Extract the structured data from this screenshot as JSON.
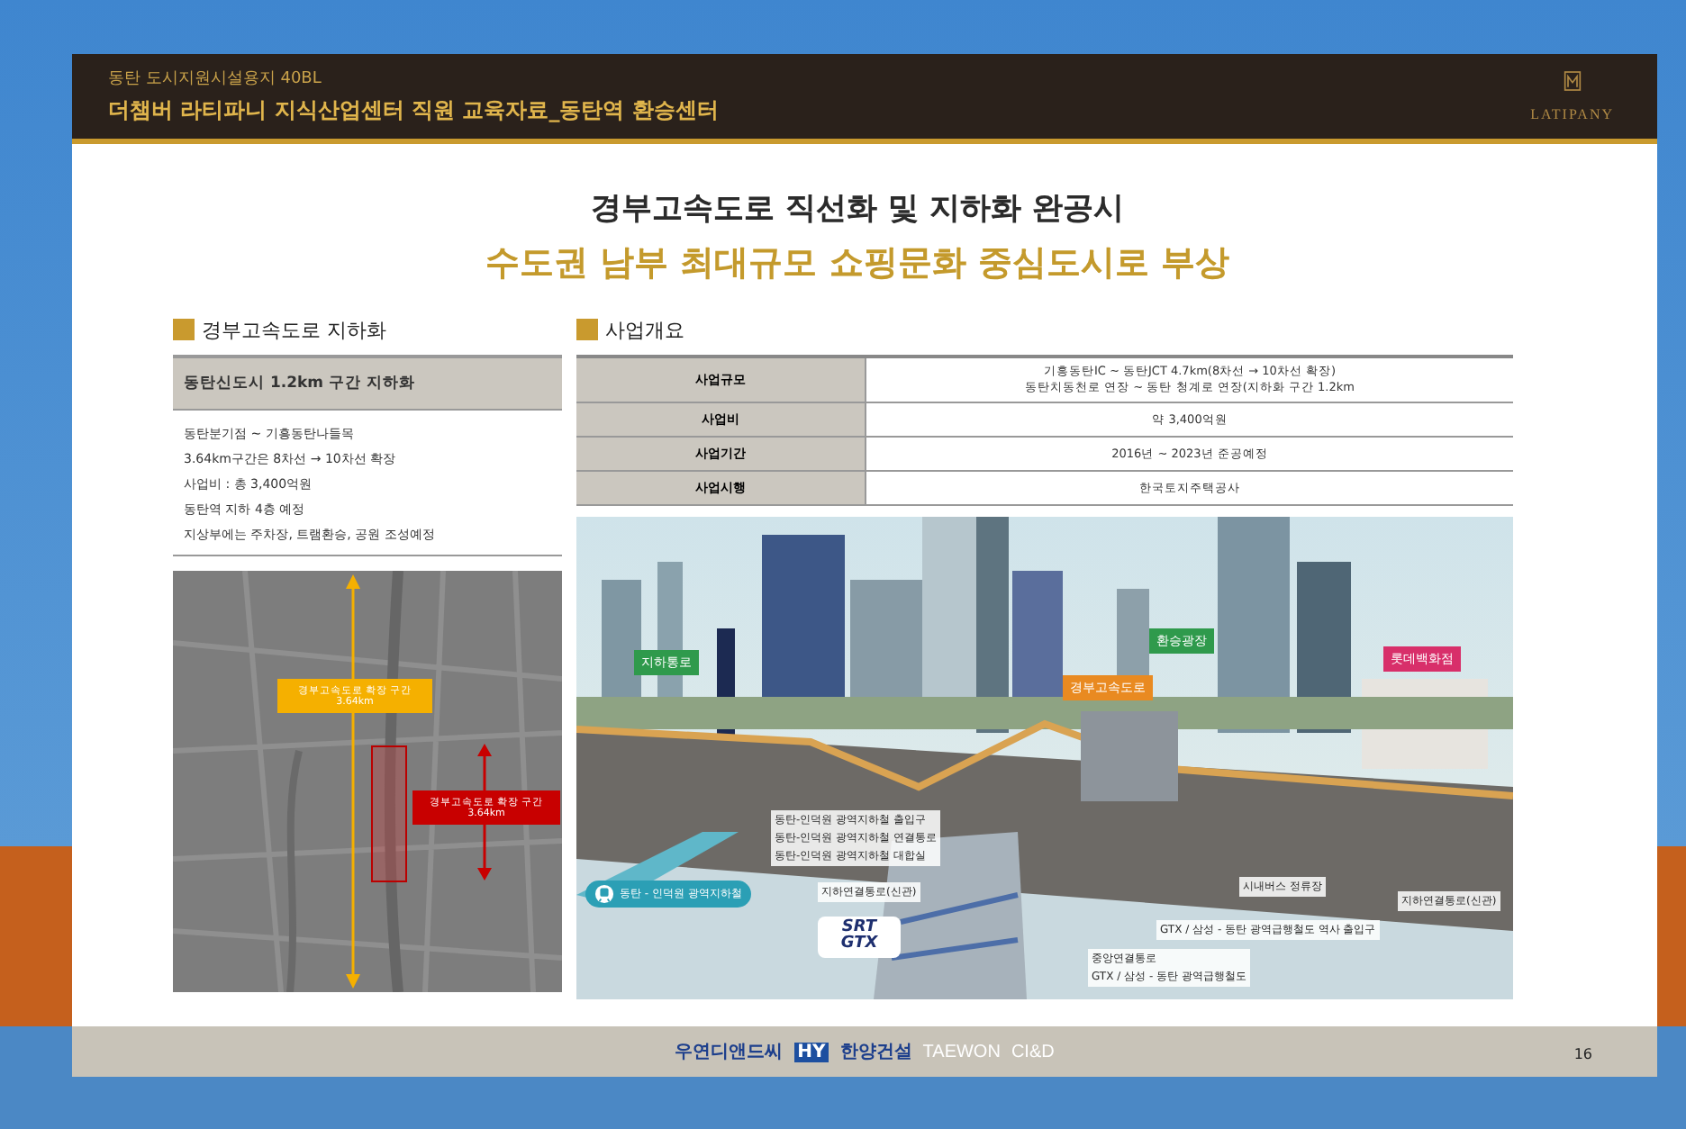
{
  "header": {
    "subtitle": "동탄 도시지원시설용지 40BL",
    "title": "더챔버 라티파니 지식산업센터 직원 교육자료_동탄역 환승센터",
    "logo": "LATIPANY"
  },
  "headline": {
    "line_1": "경부고속도로 직선화 및 지하화 완공시",
    "line_2": "수도권 남부 최대규모 쇼핑문화 중심도시로 부상"
  },
  "left_section": {
    "heading": "경부고속도로 지하화",
    "banner": "동탄신도시 1.2km 구간 지하화",
    "bullets": [
      "동탄분기점 ~ 기흥동탄나들목",
      "3.64km구간은 8차선 → 10차선 확장",
      "사업비 : 총 3,400억원",
      "동탄역 지하 4층 예정",
      "지상부에는 주차장, 트램환승, 공원 조성예정"
    ],
    "map": {
      "callouts": [
        {
          "kind": "yellow",
          "lines": [
            "경부고속도로 확장 구간",
            "3.64km"
          ]
        },
        {
          "kind": "red",
          "lines": [
            "경부고속도로 확장 구간",
            "3.64km"
          ]
        }
      ]
    }
  },
  "right_section": {
    "heading": "사업개요",
    "table": {
      "rows": [
        {
          "label": "사업규모",
          "value": [
            "기흥동탄IC ~ 동탄JCT 4.7km(8차선 → 10차선 확장)",
            "동탄치동천로 연장 ~ 동탄 청계로 연장(지하화 구간 1.2km"
          ]
        },
        {
          "label": "사업비",
          "value": [
            "약 3,400억원"
          ]
        },
        {
          "label": "사업기간",
          "value": [
            "2016년 ~ 2023년 준공예정"
          ]
        },
        {
          "label": "사업시행",
          "value": [
            "한국토지주택공사"
          ]
        }
      ]
    },
    "illustration": {
      "callouts": [
        {
          "kind": "green",
          "lines": [
            "지하통로"
          ]
        },
        {
          "kind": "green",
          "lines": [
            "환승광장"
          ]
        },
        {
          "kind": "orange",
          "lines": [
            "경부고속도로"
          ]
        },
        {
          "kind": "pink",
          "lines": [
            "롯데백화점"
          ]
        },
        {
          "kind": "note",
          "lines": [
            "동탄-인덕원 광역지하철 출입구",
            "동탄-인덕원 광역지하철 연결통로",
            "동탄-인덕원 광역지하철 대합실"
          ]
        },
        {
          "kind": "note",
          "lines": [
            "지하연결통로(신관)"
          ]
        },
        {
          "kind": "note",
          "lines": [
            "시내버스 정류장"
          ]
        },
        {
          "kind": "note",
          "lines": [
            "지하연결통로(신관)"
          ]
        },
        {
          "kind": "note",
          "lines": [
            "GTX / 삼성 - 동탄 광역급행철도 역사 출입구"
          ]
        },
        {
          "kind": "note",
          "lines": [
            "중앙연결통로",
            "GTX / 삼성 - 동탄 광역급행철도"
          ]
        },
        {
          "kind": "badge",
          "lines": [
            "동탄 - 인덕원 광역지하철"
          ]
        },
        {
          "kind": "logo",
          "lines": [
            "SRT",
            "GTX"
          ]
        }
      ]
    }
  },
  "footer": {
    "logos": [
      "우연디앤드씨",
      "HY",
      "한양건설",
      "TAEWON",
      "CI&D"
    ],
    "page": "16"
  }
}
